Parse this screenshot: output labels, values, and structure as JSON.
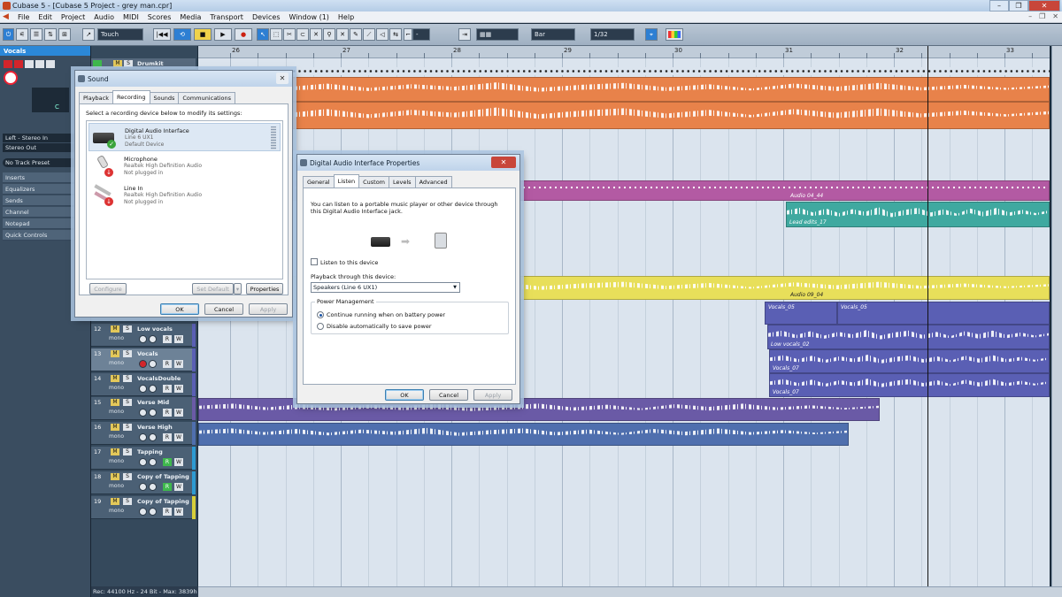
{
  "window": {
    "title": "Cubase 5 - [Cubase 5 Project - grey man.cpr]",
    "controls": [
      "–",
      "❐",
      "✕"
    ]
  },
  "menu": {
    "items": [
      "File",
      "Edit",
      "Project",
      "Audio",
      "MIDI",
      "Scores",
      "Media",
      "Transport",
      "Devices",
      "Window (1)",
      "Help"
    ],
    "right_controls": [
      "–",
      "❐",
      "✕"
    ]
  },
  "toolbar": {
    "automation_mode": "Touch",
    "snap_type": "Bar",
    "quantize": "1/32",
    "value_a": "-",
    "value_b": "-"
  },
  "inspector": {
    "track_name": "Vocals",
    "input": "Left - Stereo In",
    "output": "Stereo Out",
    "preset": "No Track Preset",
    "sections": [
      "Inserts",
      "Equalizers",
      "Sends",
      "Channel",
      "Notepad",
      "Quick Controls"
    ],
    "fader_value": "C"
  },
  "tracks": {
    "top": {
      "name": "Drumkit"
    },
    "list": [
      {
        "num": "12",
        "name": "Low vocals",
        "type": "mono",
        "color": "#5a5fb4",
        "rec": false,
        "read_on": false
      },
      {
        "num": "13",
        "name": "Vocals",
        "type": "mono",
        "color": "#5a5fb4",
        "rec": true,
        "read_on": false
      },
      {
        "num": "14",
        "name": "VocalsDouble",
        "type": "mono",
        "color": "#5a5fb4",
        "rec": false,
        "read_on": false
      },
      {
        "num": "15",
        "name": "Verse Mid",
        "type": "mono",
        "color": "#6a5aa6",
        "rec": false,
        "read_on": false
      },
      {
        "num": "16",
        "name": "Verse High",
        "type": "mono",
        "color": "#4f6fae",
        "rec": false,
        "read_on": false
      },
      {
        "num": "17",
        "name": "Tapping",
        "type": "mono",
        "color": "#2e9bd3",
        "rec": false,
        "read_on": true
      },
      {
        "num": "18",
        "name": "Copy of Tapping",
        "type": "mono",
        "color": "#2e9bd3",
        "rec": false,
        "read_on": true
      },
      {
        "num": "19",
        "name": "Copy of Tapping",
        "type": "mono",
        "color": "#d8cf3a",
        "rec": false,
        "read_on": false
      }
    ]
  },
  "ruler": {
    "bars": [
      "26",
      "27",
      "28",
      "29",
      "30",
      "31",
      "32",
      "33"
    ]
  },
  "events": {
    "audio_04_44": "Audio 04_44",
    "lead_edits_17": "Lead edits_17",
    "audio_09_04": "Audio 09_04",
    "vocals_05a": "Vocals_05",
    "vocals_05b": "Vocals_05",
    "low_vocals_02": "Low vocals_02",
    "vocals_07a": "Vocals_07",
    "vocals_07b": "Vocals_07"
  },
  "status": {
    "text": "Rec: 44100 Hz - 24 Bit - Max: 3839h 14m"
  },
  "sound_dialog": {
    "title": "Sound",
    "tabs": [
      "Playback",
      "Recording",
      "Sounds",
      "Communications"
    ],
    "selected_tab": 1,
    "instruction": "Select a recording device below to modify its settings:",
    "devices": [
      {
        "name": "Digital Audio Interface",
        "desc": "Line 6 UX1",
        "status": "Default Device",
        "selected": true
      },
      {
        "name": "Microphone",
        "desc": "Realtek High Definition Audio",
        "status": "Not plugged in",
        "selected": false
      },
      {
        "name": "Line In",
        "desc": "Realtek High Definition Audio",
        "status": "Not plugged in",
        "selected": false
      }
    ],
    "buttons": {
      "configure": "Configure",
      "set_default": "Set Default",
      "properties": "Properties",
      "ok": "OK",
      "cancel": "Cancel",
      "apply": "Apply"
    }
  },
  "props_dialog": {
    "title": "Digital Audio Interface Properties",
    "tabs": [
      "General",
      "Listen",
      "Custom",
      "Levels",
      "Advanced"
    ],
    "selected_tab": 1,
    "description": "You can listen to a portable music player or other device through this Digital Audio Interface jack.",
    "listen_checkbox": "Listen to this device",
    "listen_checked": false,
    "playback_label": "Playback through this device:",
    "playback_value": "Speakers (Line 6 UX1)",
    "power_group": "Power Management",
    "power_options": [
      "Continue running when on battery power",
      "Disable automatically to save power"
    ],
    "power_selected": 0,
    "buttons": {
      "ok": "OK",
      "cancel": "Cancel",
      "apply": "Apply"
    }
  },
  "colors": {
    "orange": "#e8824a",
    "purple": "#b35aa3",
    "teal": "#3fa9a0",
    "yellow": "#e8df5a",
    "blue": "#5a5fb4",
    "violet": "#6a5aa6",
    "steel": "#4f6fae"
  }
}
